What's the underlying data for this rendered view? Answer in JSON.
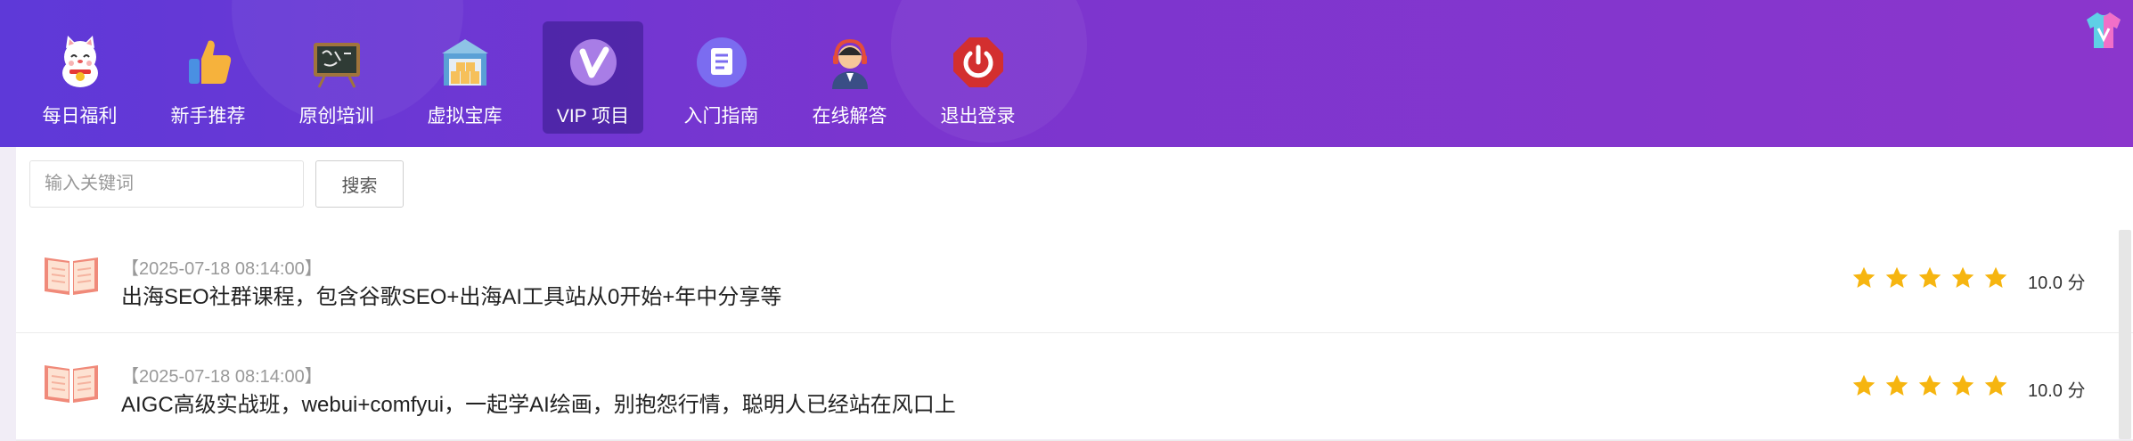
{
  "nav": {
    "items": [
      {
        "label": "每日福利",
        "icon": "lucky-cat-icon"
      },
      {
        "label": "新手推荐",
        "icon": "thumbs-up-icon"
      },
      {
        "label": "原创培训",
        "icon": "chalkboard-icon"
      },
      {
        "label": "虚拟宝库",
        "icon": "warehouse-icon"
      },
      {
        "label": "VIP 项目",
        "icon": "vip-badge-icon",
        "active": true
      },
      {
        "label": "入门指南",
        "icon": "document-icon"
      },
      {
        "label": "在线解答",
        "icon": "support-agent-icon"
      },
      {
        "label": "退出登录",
        "icon": "power-icon"
      }
    ]
  },
  "search": {
    "placeholder": "输入关键词",
    "value": "",
    "button_label": "搜索"
  },
  "list": [
    {
      "date": "【2025-07-18 08:14:00】",
      "title": "出海SEO社群课程，包含谷歌SEO+出海AI工具站从0开始+年中分享等",
      "rating_stars": 5,
      "score": "10.0 分"
    },
    {
      "date": "【2025-07-18 08:14:00】",
      "title": "AIGC高级实战班，webui+comfyui，一起学AI绘画，别抱怨行情，聪明人已经站在风口上",
      "rating_stars": 5,
      "score": "10.0 分"
    }
  ],
  "colors": {
    "header_start": "#5e39d8",
    "header_end": "#8b36cc",
    "star": "#f6b510",
    "book": "#f08a7a"
  }
}
